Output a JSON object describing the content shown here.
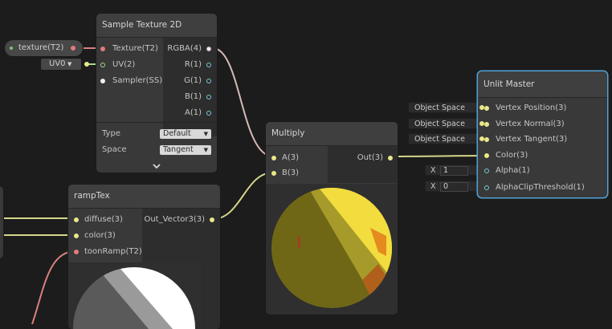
{
  "texture_property": {
    "label": "texture(T2)"
  },
  "uv_channel": {
    "value": "UV0"
  },
  "sample_texture": {
    "title": "Sample Texture 2D",
    "inputs": [
      "Texture(T2)",
      "UV(2)",
      "Sampler(SS)"
    ],
    "outputs": [
      "RGBA(4)",
      "R(1)",
      "G(1)",
      "B(1)",
      "A(1)"
    ],
    "settings": [
      {
        "label": "Type",
        "value": "Default"
      },
      {
        "label": "Space",
        "value": "Tangent"
      }
    ],
    "expand_icon": "chevron-down-icon"
  },
  "multiply": {
    "title": "Multiply",
    "inputs": [
      "A(3)",
      "B(3)"
    ],
    "output": "Out(3)"
  },
  "ramp_tex": {
    "title": "rampTex",
    "inputs": [
      "diffuse(3)",
      "color(3)",
      "toonRamp(T2)"
    ],
    "output": "Out_Vector3(3)"
  },
  "unlit_master": {
    "title": "Unlit Master",
    "inputs": [
      "Vertex Position(3)",
      "Vertex Normal(3)",
      "Vertex Tangent(3)",
      "Color(3)",
      "Alpha(1)",
      "AlphaClipThreshold(1)"
    ],
    "space_fields": [
      "Object Space",
      "Object Space",
      "Object Space"
    ],
    "alpha_field": {
      "axis": "X",
      "value": "1"
    },
    "clip_field": {
      "axis": "X",
      "value": "0"
    }
  },
  "colors": {
    "background": "#1c1c1c",
    "node": "#393939",
    "wire_vector3": "#d6d68a",
    "wire_texture": "#d98080",
    "wire_vector4": "#d7b9b9",
    "selection": "#4fa3d9"
  }
}
